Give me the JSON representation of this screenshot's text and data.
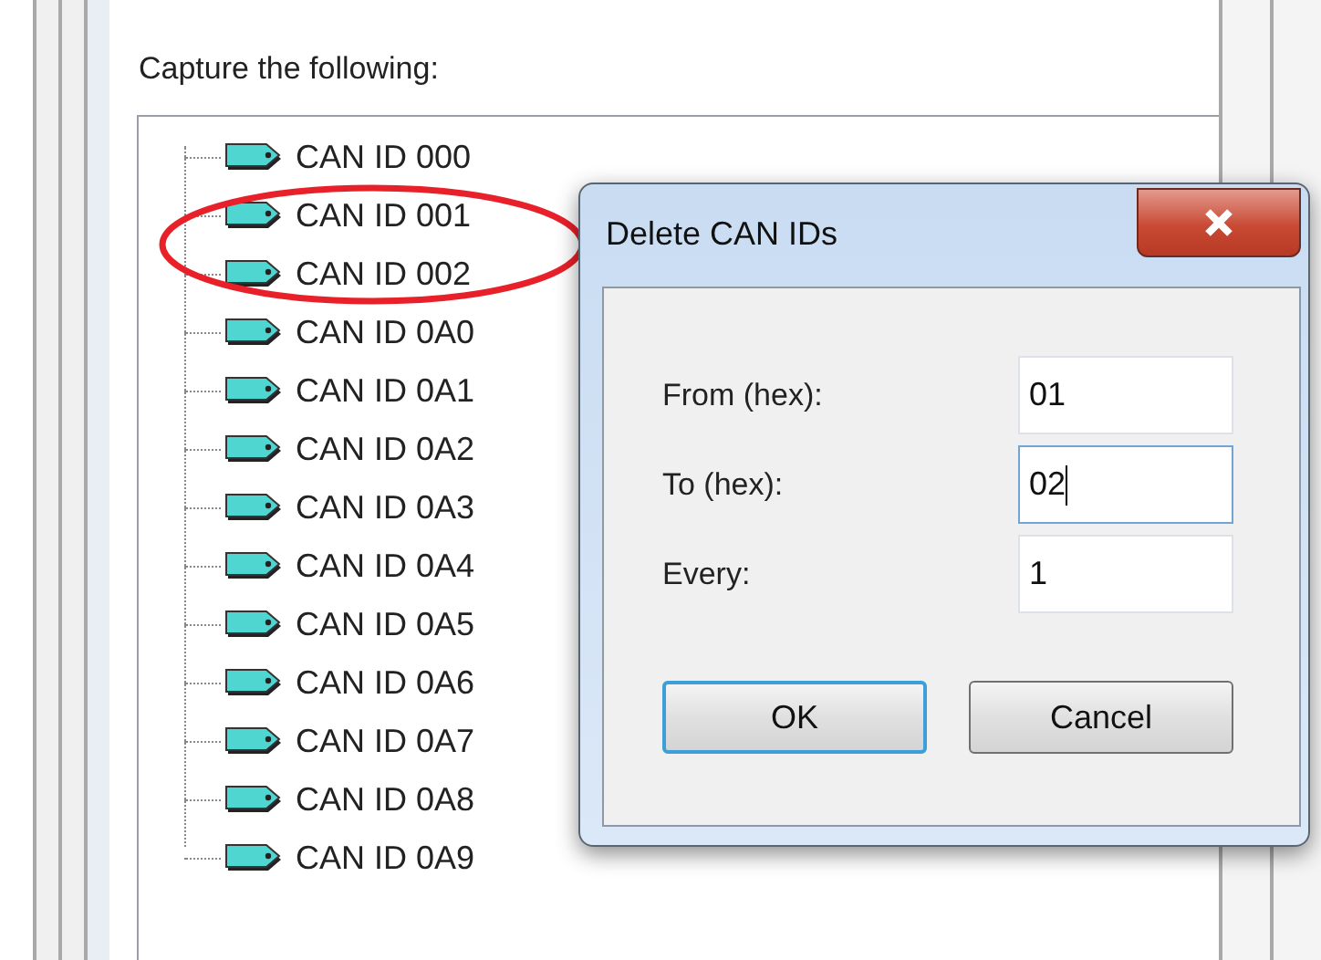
{
  "panel": {
    "heading": "Capture the following:"
  },
  "tree": {
    "items": [
      {
        "label": "CAN ID 000"
      },
      {
        "label": "CAN ID 001"
      },
      {
        "label": "CAN ID 002"
      },
      {
        "label": "CAN ID 0A0"
      },
      {
        "label": "CAN ID 0A1"
      },
      {
        "label": "CAN ID 0A2"
      },
      {
        "label": "CAN ID 0A3"
      },
      {
        "label": "CAN ID 0A4"
      },
      {
        "label": "CAN ID 0A5"
      },
      {
        "label": "CAN ID 0A6"
      },
      {
        "label": "CAN ID 0A7"
      },
      {
        "label": "CAN ID 0A8"
      },
      {
        "label": "CAN ID 0A9"
      }
    ]
  },
  "dialog": {
    "title": "Delete CAN IDs",
    "fields": [
      {
        "label": "From (hex):",
        "value": "01",
        "focused": false
      },
      {
        "label": "To (hex):",
        "value": "02",
        "focused": true
      },
      {
        "label": "Every:",
        "value": "1",
        "focused": false
      }
    ],
    "buttons": [
      {
        "label": "OK",
        "default": true
      },
      {
        "label": "Cancel",
        "default": false
      }
    ]
  }
}
